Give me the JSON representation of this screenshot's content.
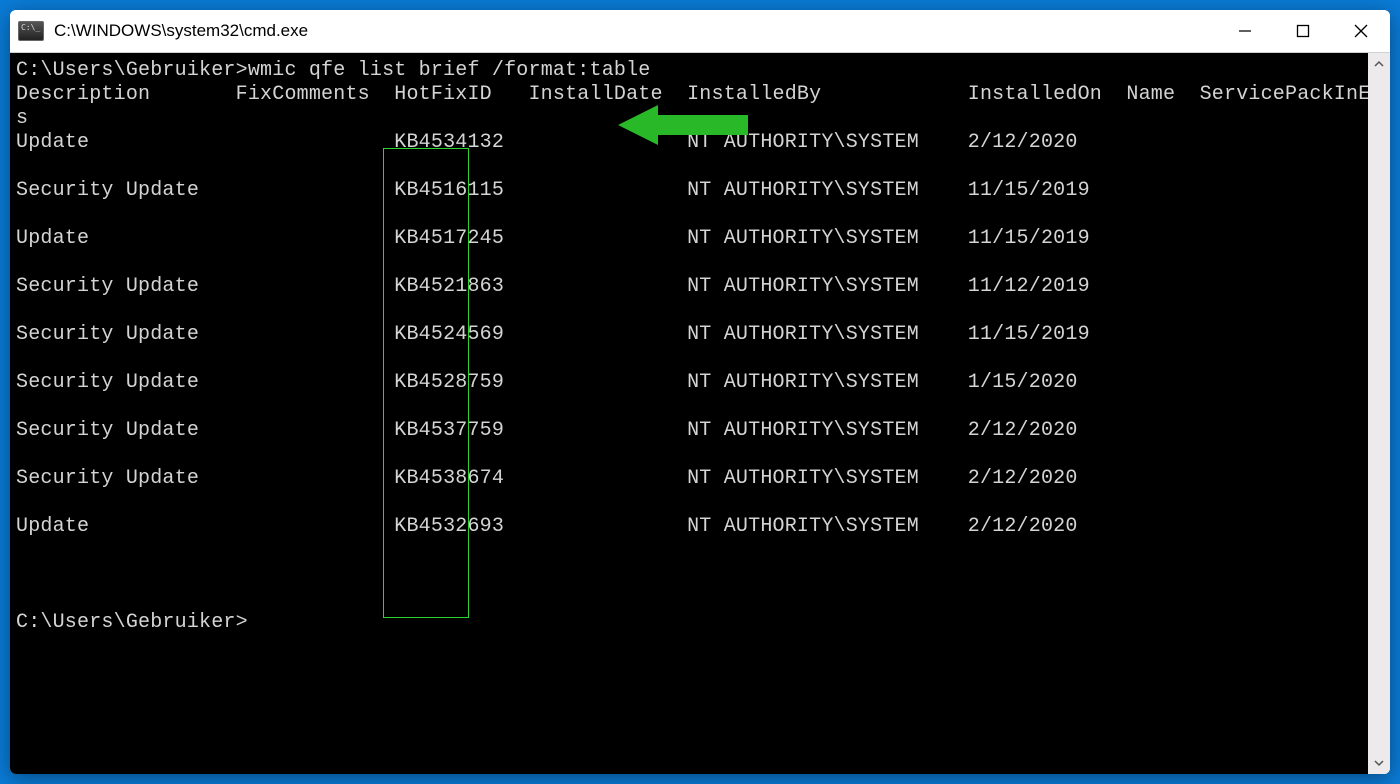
{
  "window": {
    "title": "C:\\WINDOWS\\system32\\cmd.exe"
  },
  "terminal": {
    "prompt1": "C:\\Users\\Gebruiker>",
    "command": "wmic qfe list brief /format:table",
    "headers_line1": "Description       FixComments  HotFixID   InstallDate  InstalledBy            InstalledOn  Name  ServicePackInEffect  Statu",
    "headers_line2": "s",
    "prompt2": "C:\\Users\\Gebruiker>",
    "columns": [
      "Description",
      "FixComments",
      "HotFixID",
      "InstallDate",
      "InstalledBy",
      "InstalledOn",
      "Name",
      "ServicePackInEffect",
      "Status"
    ],
    "rows": [
      {
        "Description": "Update",
        "FixComments": "",
        "HotFixID": "KB4534132",
        "InstallDate": "",
        "InstalledBy": "NT AUTHORITY\\SYSTEM",
        "InstalledOn": "2/12/2020"
      },
      {
        "Description": "Security Update",
        "FixComments": "",
        "HotFixID": "KB4516115",
        "InstallDate": "",
        "InstalledBy": "NT AUTHORITY\\SYSTEM",
        "InstalledOn": "11/15/2019"
      },
      {
        "Description": "Update",
        "FixComments": "",
        "HotFixID": "KB4517245",
        "InstallDate": "",
        "InstalledBy": "NT AUTHORITY\\SYSTEM",
        "InstalledOn": "11/15/2019"
      },
      {
        "Description": "Security Update",
        "FixComments": "",
        "HotFixID": "KB4521863",
        "InstallDate": "",
        "InstalledBy": "NT AUTHORITY\\SYSTEM",
        "InstalledOn": "11/12/2019"
      },
      {
        "Description": "Security Update",
        "FixComments": "",
        "HotFixID": "KB4524569",
        "InstallDate": "",
        "InstalledBy": "NT AUTHORITY\\SYSTEM",
        "InstalledOn": "11/15/2019"
      },
      {
        "Description": "Security Update",
        "FixComments": "",
        "HotFixID": "KB4528759",
        "InstallDate": "",
        "InstalledBy": "NT AUTHORITY\\SYSTEM",
        "InstalledOn": "1/15/2020"
      },
      {
        "Description": "Security Update",
        "FixComments": "",
        "HotFixID": "KB4537759",
        "InstallDate": "",
        "InstalledBy": "NT AUTHORITY\\SYSTEM",
        "InstalledOn": "2/12/2020"
      },
      {
        "Description": "Security Update",
        "FixComments": "",
        "HotFixID": "KB4538674",
        "InstallDate": "",
        "InstalledBy": "NT AUTHORITY\\SYSTEM",
        "InstalledOn": "2/12/2020"
      },
      {
        "Description": "Update",
        "FixComments": "",
        "HotFixID": "KB4532693",
        "InstallDate": "",
        "InstalledBy": "NT AUTHORITY\\SYSTEM",
        "InstalledOn": "2/12/2020"
      }
    ]
  }
}
